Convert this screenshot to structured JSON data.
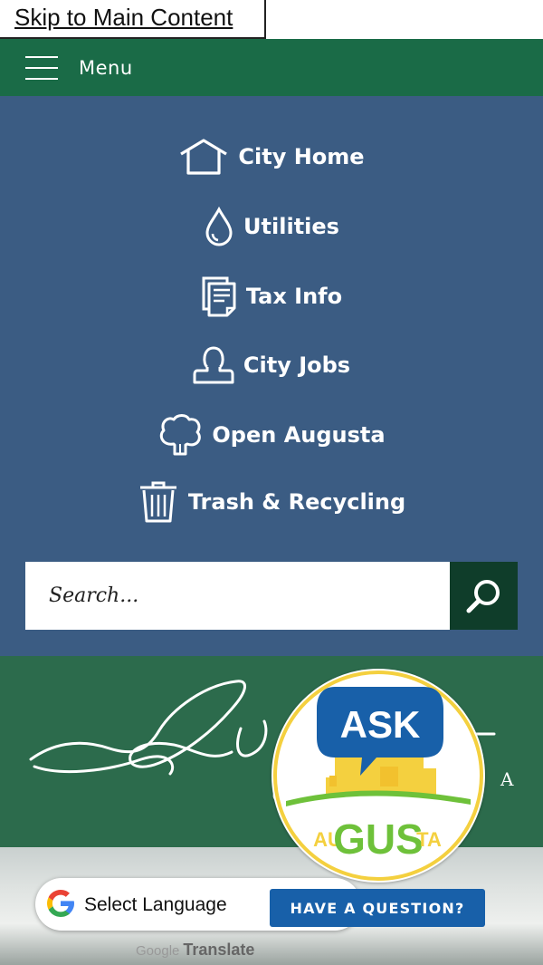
{
  "skip_link": "Skip to Main Content",
  "topbar": {
    "menu_label": "Menu"
  },
  "nav": {
    "items": [
      {
        "label": "City Home",
        "icon": "house-icon"
      },
      {
        "label": "Utilities",
        "icon": "water-drop-icon"
      },
      {
        "label": "Tax Info",
        "icon": "document-icon"
      },
      {
        "label": "City Jobs",
        "icon": "person-icon"
      },
      {
        "label": "Open Augusta",
        "icon": "tree-icon"
      },
      {
        "label": "Trash & Recycling",
        "icon": "trash-can-icon"
      }
    ]
  },
  "search": {
    "placeholder": "Search...",
    "icon": "search-icon"
  },
  "banner": {
    "script_text": "Augusta",
    "trailing_letter": "A"
  },
  "ask_gus": {
    "top": "ASK",
    "left": "AU",
    "middle": "GUS",
    "right": "TA",
    "button": "HAVE A QUESTION?"
  },
  "translate": {
    "select_label": "Select Language",
    "powered_by": "Google",
    "translate_label": "Translate"
  },
  "colors": {
    "topbar": "#1a6b47",
    "nav_bg": "#3b5c83",
    "search_button": "#0f3d2a",
    "banner": "#2c6b4c",
    "ask_blue": "#1860a9",
    "gus_yellow": "#f4d03f",
    "gus_green": "#6ec13a"
  }
}
